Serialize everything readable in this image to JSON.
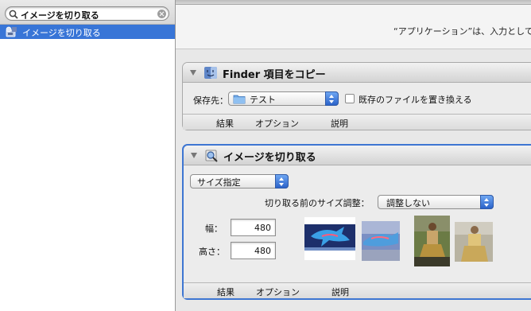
{
  "search": {
    "value": "イメージを切り取る"
  },
  "results": [
    {
      "label": "イメージを切り取る",
      "icon": "automator-robot-icon"
    }
  ],
  "header": {
    "description": "“アプリケーション”は、入力として"
  },
  "actions": [
    {
      "title": "Finder 項目をコピー",
      "icon": "finder-icon",
      "destination_label": "保存先：",
      "destination_value": "テスト",
      "replace_label": "既存のファイルを置き換える",
      "replace_checked": false,
      "tabs": [
        "結果",
        "オプション",
        "説明"
      ]
    },
    {
      "title": "イメージを切り取る",
      "icon": "preview-icon",
      "mode_value": "サイズ指定",
      "scale_label": "切り取る前のサイズ調整：",
      "scale_value": "調整しない",
      "width_label": "幅：",
      "width_value": "480",
      "height_label": "高さ：",
      "height_value": "480",
      "tabs": [
        "結果",
        "オプション",
        "説明"
      ]
    }
  ],
  "colors": {
    "selection": "#3875d7",
    "selected_action_border": "#3e76d2"
  }
}
